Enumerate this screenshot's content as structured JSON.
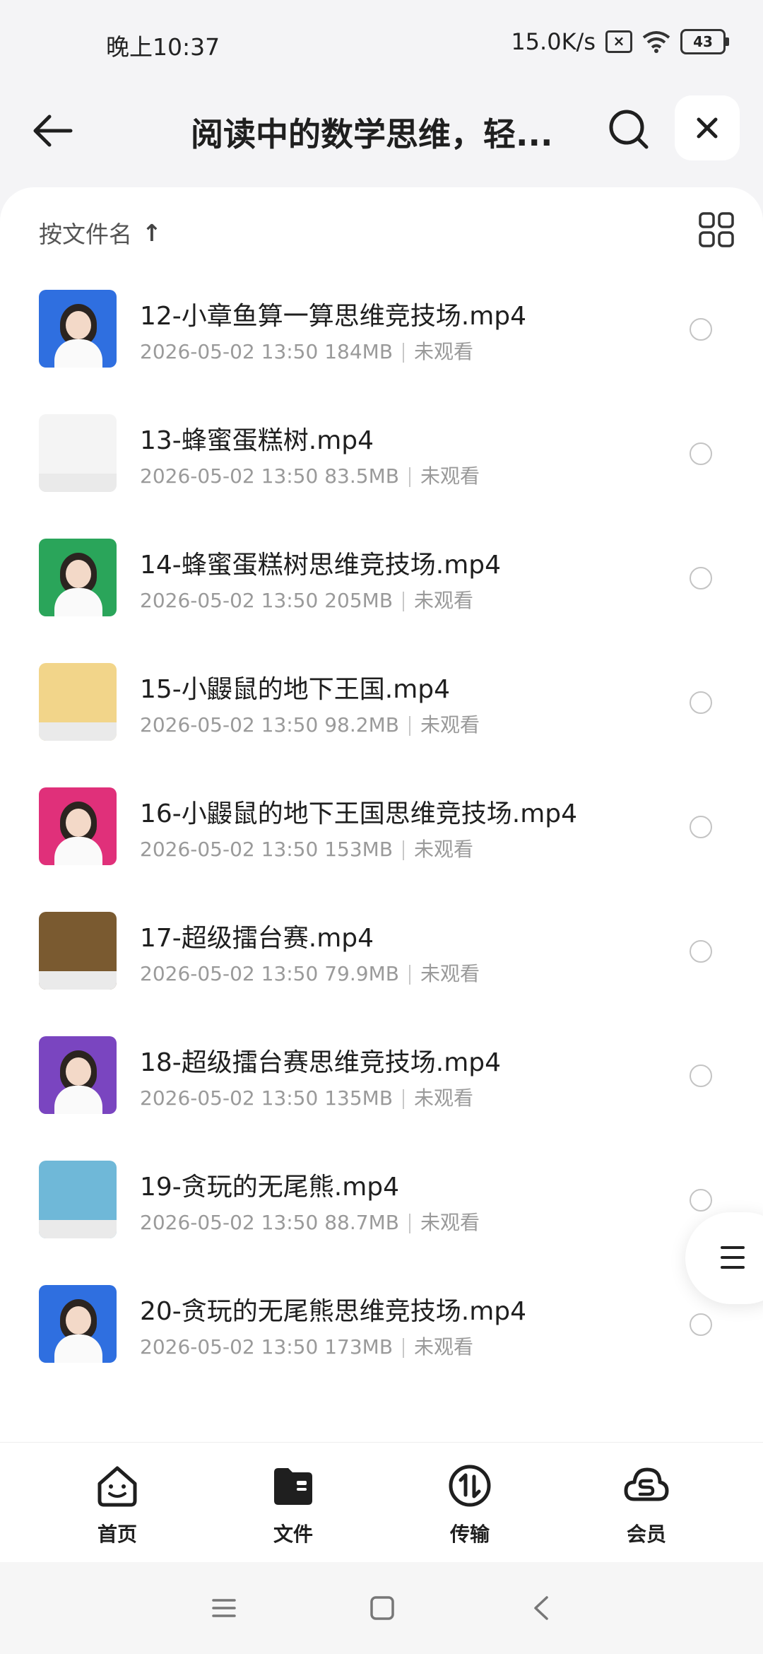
{
  "status_bar": {
    "time": "晚上10:37",
    "speed": "15.0K/s",
    "battery": "43"
  },
  "header": {
    "title": "阅读中的数学思维，轻..."
  },
  "sort": {
    "label": "按文件名",
    "arrow": "↑"
  },
  "files": [
    {
      "name": "12-小章鱼算一算思维竞技场.mp4",
      "date": "2026-05-02 13:50",
      "size": "184MB",
      "status": "未观看",
      "thumb_color": "#2f6fe0"
    },
    {
      "name": "13-蜂蜜蛋糕树.mp4",
      "date": "2026-05-02 13:50",
      "size": "83.5MB",
      "status": "未观看",
      "thumb_color": "#f4f4f4"
    },
    {
      "name": "14-蜂蜜蛋糕树思维竞技场.mp4",
      "date": "2026-05-02 13:50",
      "size": "205MB",
      "status": "未观看",
      "thumb_color": "#2aa55a"
    },
    {
      "name": "15-小鼹鼠的地下王国.mp4",
      "date": "2026-05-02 13:50",
      "size": "98.2MB",
      "status": "未观看",
      "thumb_color": "#f2d58a"
    },
    {
      "name": "16-小鼹鼠的地下王国思维竞技场.mp4",
      "date": "2026-05-02 13:50",
      "size": "153MB",
      "status": "未观看",
      "thumb_color": "#e0307a"
    },
    {
      "name": "17-超级擂台赛.mp4",
      "date": "2026-05-02 13:50",
      "size": "79.9MB",
      "status": "未观看",
      "thumb_color": "#7a5a30"
    },
    {
      "name": "18-超级擂台赛思维竞技场.mp4",
      "date": "2026-05-02 13:50",
      "size": "135MB",
      "status": "未观看",
      "thumb_color": "#7a45c0"
    },
    {
      "name": "19-贪玩的无尾熊.mp4",
      "date": "2026-05-02 13:50",
      "size": "88.7MB",
      "status": "未观看",
      "thumb_color": "#6fb8d8"
    },
    {
      "name": "20-贪玩的无尾熊思维竞技场.mp4",
      "date": "2026-05-02 13:50",
      "size": "173MB",
      "status": "未观看",
      "thumb_color": "#2f6fe0"
    }
  ],
  "tabs": [
    {
      "label": "首页",
      "icon": "home-smile-icon"
    },
    {
      "label": "文件",
      "icon": "folder-icon"
    },
    {
      "label": "传输",
      "icon": "transfer-icon"
    },
    {
      "label": "会员",
      "icon": "vip-cloud-icon"
    }
  ]
}
